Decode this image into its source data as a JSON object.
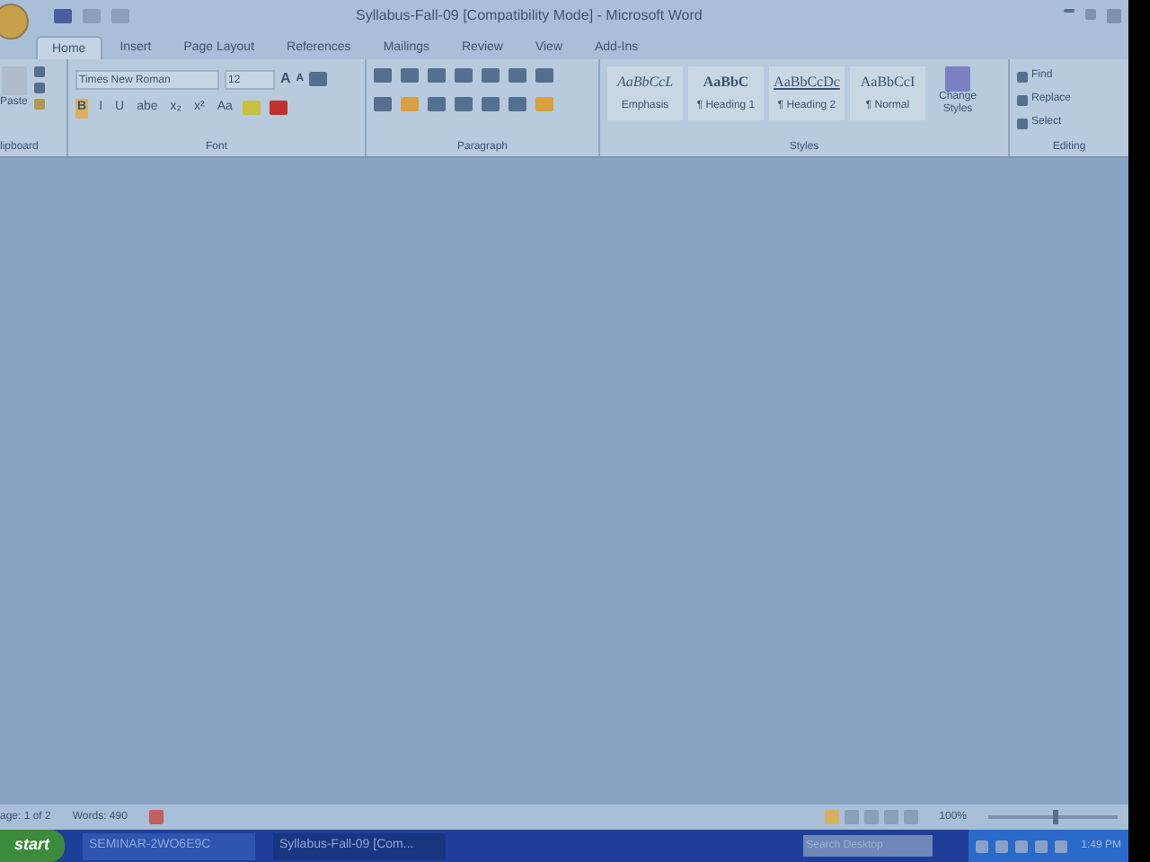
{
  "window": {
    "title": "Syllabus-Fall-09 [Compatibility Mode] - Microsoft Word"
  },
  "tabs": [
    {
      "label": "Home",
      "selected": true
    },
    {
      "label": "Insert",
      "selected": false
    },
    {
      "label": "Page Layout",
      "selected": false
    },
    {
      "label": "References",
      "selected": false
    },
    {
      "label": "Mailings",
      "selected": false
    },
    {
      "label": "Review",
      "selected": false
    },
    {
      "label": "View",
      "selected": false
    },
    {
      "label": "Add-Ins",
      "selected": false
    }
  ],
  "ribbon": {
    "clipboard": {
      "paste": "Paste",
      "label": "lipboard"
    },
    "font": {
      "name": "Times New Roman",
      "size": "12",
      "grow": "A",
      "shrink": "A",
      "format_buttons": [
        "B",
        "I",
        "U",
        "abe",
        "x₂",
        "x²",
        "Aa"
      ],
      "label": "Font"
    },
    "paragraph": {
      "label": "Paragraph"
    },
    "styles": {
      "items": [
        {
          "preview": "AaBbCcL",
          "name": "Emphasis",
          "kind": "italic"
        },
        {
          "preview": "AaBbC",
          "name": "¶ Heading 1",
          "kind": "bold"
        },
        {
          "preview": "AaBbCcDc",
          "name": "¶ Heading 2",
          "kind": "underline"
        },
        {
          "preview": "AaBbCcI",
          "name": "¶ Normal",
          "kind": "plain"
        }
      ],
      "change": "Change Styles",
      "label": "Styles"
    },
    "editing": {
      "items": [
        "Find",
        "Replace",
        "Select"
      ],
      "label": "Editing"
    }
  },
  "status_bar": {
    "page": "age: 1 of 2",
    "words": "Words: 490",
    "zoom": "100%",
    "zoom_slider": {
      "level": 0.5
    }
  },
  "taskbar": {
    "start": "start",
    "tasks": [
      {
        "label": "SEMINAR-2WO6E9C",
        "selected": false
      },
      {
        "label": "Syllabus-Fall-09 [Com...",
        "selected": true
      }
    ],
    "search": {
      "placeholder": "Search Desktop"
    },
    "clock": "1:49 PM"
  }
}
